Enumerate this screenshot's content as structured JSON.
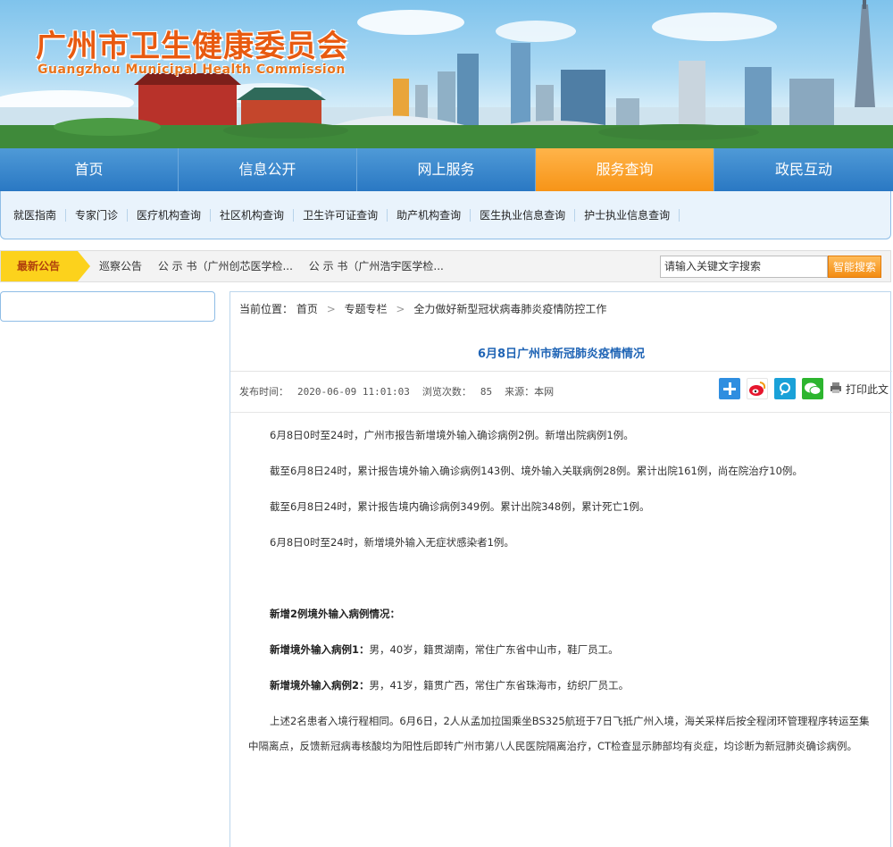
{
  "header": {
    "title_cn": "广州市卫生健康委员会",
    "title_en": "Guangzhou Municipal Health Commission"
  },
  "nav": {
    "items": [
      "首页",
      "信息公开",
      "网上服务",
      "服务查询",
      "政民互动"
    ],
    "active_index": 3
  },
  "subnav": {
    "items": [
      "就医指南",
      "专家门诊",
      "医疗机构查询",
      "社区机构查询",
      "卫生许可证查询",
      "助产机构查询",
      "医生执业信息查询",
      "护士执业信息查询"
    ]
  },
  "notice": {
    "tag": "最新公告",
    "items": [
      "巡察公告",
      "公 示 书（广州创芯医学检...",
      "公 示 书（广州浩宇医学检..."
    ]
  },
  "search": {
    "placeholder": "请输入关键文字搜索",
    "button": "智能搜索"
  },
  "breadcrumb": {
    "label": "当前位置：",
    "items": [
      "首页",
      "专题专栏",
      "全力做好新型冠状病毒肺炎疫情防控工作"
    ]
  },
  "article": {
    "title": "6月8日广州市新冠肺炎疫情情况",
    "publish_label": "发布时间：",
    "publish_time": "2020-06-09 11:01:03",
    "views_label": "浏览次数：",
    "views": "85",
    "source_label": "来源：",
    "source": "本网",
    "print_label": "打印此文",
    "paragraphs": {
      "p1": "6月8日0时至24时，广州市报告新增境外输入确诊病例2例。新增出院病例1例。",
      "p2": "截至6月8日24时，累计报告境外输入确诊病例143例、境外输入关联病例28例。累计出院161例，尚在院治疗10例。",
      "p3": "截至6月8日24时，累计报告境内确诊病例349例。累计出院348例，累计死亡1例。",
      "p4": "6月8日0时至24时，新增境外输入无症状感染者1例。",
      "p5_heading": "新增2例境外输入病例情况：",
      "p6_label": "新增境外输入病例1：",
      "p6_text": "男，40岁，籍贯湖南，常住广东省中山市，鞋厂员工。",
      "p7_label": "新增境外输入病例2：",
      "p7_text": "男，41岁，籍贯广西，常住广东省珠海市，纺织厂员工。",
      "p8": "上述2名患者入境行程相同。6月6日，2人从孟加拉国乘坐BS325航班于7日飞抵广州入境，海关采样后按全程闭环管理程序转运至集中隔离点，反馈新冠病毒核酸均为阳性后即转广州市第八人民医院隔离治疗，CT检查显示肺部均有炎症，均诊断为新冠肺炎确诊病例。"
    }
  },
  "share_icons": [
    "plus-share-icon",
    "weibo-icon",
    "tencent-weibo-icon",
    "wechat-icon",
    "print-icon"
  ],
  "colors": {
    "nav_blue": "#2a78c3",
    "nav_active": "#f79417",
    "title_blue": "#1f64b5",
    "brand_orange": "#e85a10",
    "notice_yellow": "#fcd21c"
  }
}
